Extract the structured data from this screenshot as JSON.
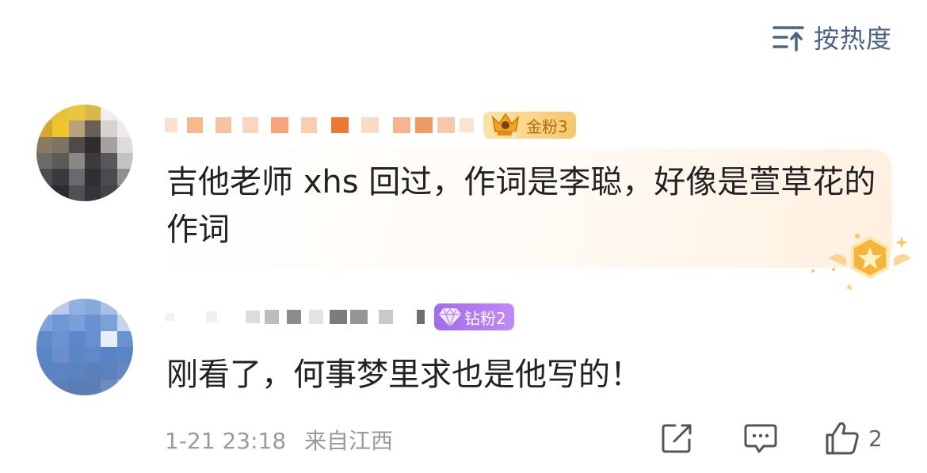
{
  "sort": {
    "label": "按热度",
    "icon": "sort-icon"
  },
  "comments": [
    {
      "badge_label": "金粉3",
      "badge_icon": "crown-trophy-icon",
      "text": "吉他老师 xhs 回过，作词是李聪，好像是萱草花的作词",
      "decoration_icon": "star-medal-icon"
    },
    {
      "badge_label": "钻粉2",
      "badge_icon": "diamond-icon",
      "text": "刚看了，何事梦里求也是他写的！",
      "meta": {
        "time": "1-21 23:18",
        "location": "来自江西"
      },
      "actions": {
        "share_icon": "share-edit-icon",
        "reply_icon": "comment-icon",
        "like_icon": "thumbs-up-icon",
        "like_count": "2"
      }
    }
  ],
  "colors": {
    "sort_text": "#4b6386",
    "gold_badge": "#f7c76a",
    "diamond_badge": "#a26af0",
    "meta_text": "#9a9a9a"
  }
}
